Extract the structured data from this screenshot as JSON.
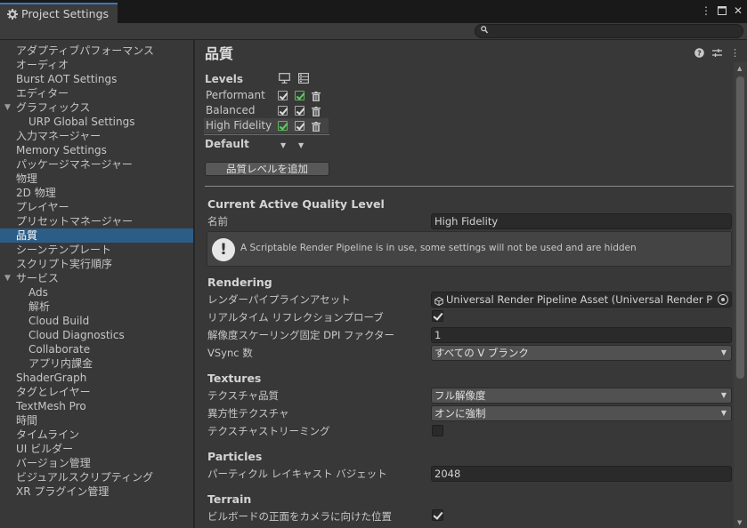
{
  "window": {
    "tab_title": "Project Settings"
  },
  "search": {
    "placeholder": ""
  },
  "sidebar": {
    "items": [
      {
        "label": "アダプティブパフォーマンス",
        "level": 0
      },
      {
        "label": "オーディオ",
        "level": 0
      },
      {
        "label": "Burst AOT Settings",
        "level": 0
      },
      {
        "label": "エディター",
        "level": 0
      },
      {
        "label": "グラフィックス",
        "level": 0,
        "expanded": true
      },
      {
        "label": "URP Global Settings",
        "level": 1
      },
      {
        "label": "入力マネージャー",
        "level": 0
      },
      {
        "label": "Memory Settings",
        "level": 0
      },
      {
        "label": "パッケージマネージャー",
        "level": 0
      },
      {
        "label": "物理",
        "level": 0
      },
      {
        "label": "2D 物理",
        "level": 0
      },
      {
        "label": "プレイヤー",
        "level": 0
      },
      {
        "label": "プリセットマネージャー",
        "level": 0
      },
      {
        "label": "品質",
        "level": 0,
        "selected": true
      },
      {
        "label": "シーンテンプレート",
        "level": 0
      },
      {
        "label": "スクリプト実行順序",
        "level": 0
      },
      {
        "label": "サービス",
        "level": 0,
        "expanded": true
      },
      {
        "label": "Ads",
        "level": 1
      },
      {
        "label": "解析",
        "level": 1
      },
      {
        "label": "Cloud Build",
        "level": 1
      },
      {
        "label": "Cloud Diagnostics",
        "level": 1
      },
      {
        "label": "Collaborate",
        "level": 1
      },
      {
        "label": "アプリ内課金",
        "level": 1
      },
      {
        "label": "ShaderGraph",
        "level": 0
      },
      {
        "label": "タグとレイヤー",
        "level": 0
      },
      {
        "label": "TextMesh Pro",
        "level": 0
      },
      {
        "label": "時間",
        "level": 0
      },
      {
        "label": "タイムライン",
        "level": 0
      },
      {
        "label": "UI ビルダー",
        "level": 0
      },
      {
        "label": "バージョン管理",
        "level": 0
      },
      {
        "label": "ビジュアルスクリプティング",
        "level": 0
      },
      {
        "label": "XR プラグイン管理",
        "level": 0
      }
    ]
  },
  "main": {
    "title": "品質",
    "levels": {
      "header": "Levels",
      "rows": [
        {
          "name": "Performant",
          "pc": true,
          "pc_green": false,
          "mobile": true,
          "mobile_green": true
        },
        {
          "name": "Balanced",
          "pc": true,
          "pc_green": false,
          "mobile": true,
          "mobile_green": false
        },
        {
          "name": "High Fidelity",
          "pc": true,
          "pc_green": true,
          "mobile": true,
          "mobile_green": false
        }
      ],
      "default_label": "Default",
      "add_button": "品質レベルを追加"
    },
    "current": {
      "header": "Current Active Quality Level",
      "name_label": "名前",
      "name_value": "High Fidelity",
      "warning": "A Scriptable Render Pipeline is in use, some settings will not be used and are hidden"
    },
    "rendering": {
      "header": "Rendering",
      "pipeline_label": "レンダーパイプラインアセット",
      "pipeline_value": "Universal Render Pipeline Asset (Universal Render P",
      "realtime_reflection_label": "リアルタイム リフレクションプローブ",
      "realtime_reflection_checked": true,
      "dpi_label": "解像度スケーリング固定 DPI ファクター",
      "dpi_value": "1",
      "vsync_label": "VSync 数",
      "vsync_value": "すべての V ブランク"
    },
    "textures": {
      "header": "Textures",
      "quality_label": "テクスチャ品質",
      "quality_value": "フル解像度",
      "aniso_label": "異方性テクスチャ",
      "aniso_value": "オンに強制",
      "streaming_label": "テクスチャストリーミング",
      "streaming_checked": false
    },
    "particles": {
      "header": "Particles",
      "raycast_label": "パーティクル レイキャスト バジェット",
      "raycast_value": "2048"
    },
    "terrain": {
      "header": "Terrain",
      "billboard_label": "ビルボードの正面をカメラに向けた位置",
      "billboard_checked": true
    }
  },
  "colors": {
    "selection": "#2c5d87",
    "tab_accent": "#3a79bb",
    "check_green": "#5ccf5c"
  }
}
